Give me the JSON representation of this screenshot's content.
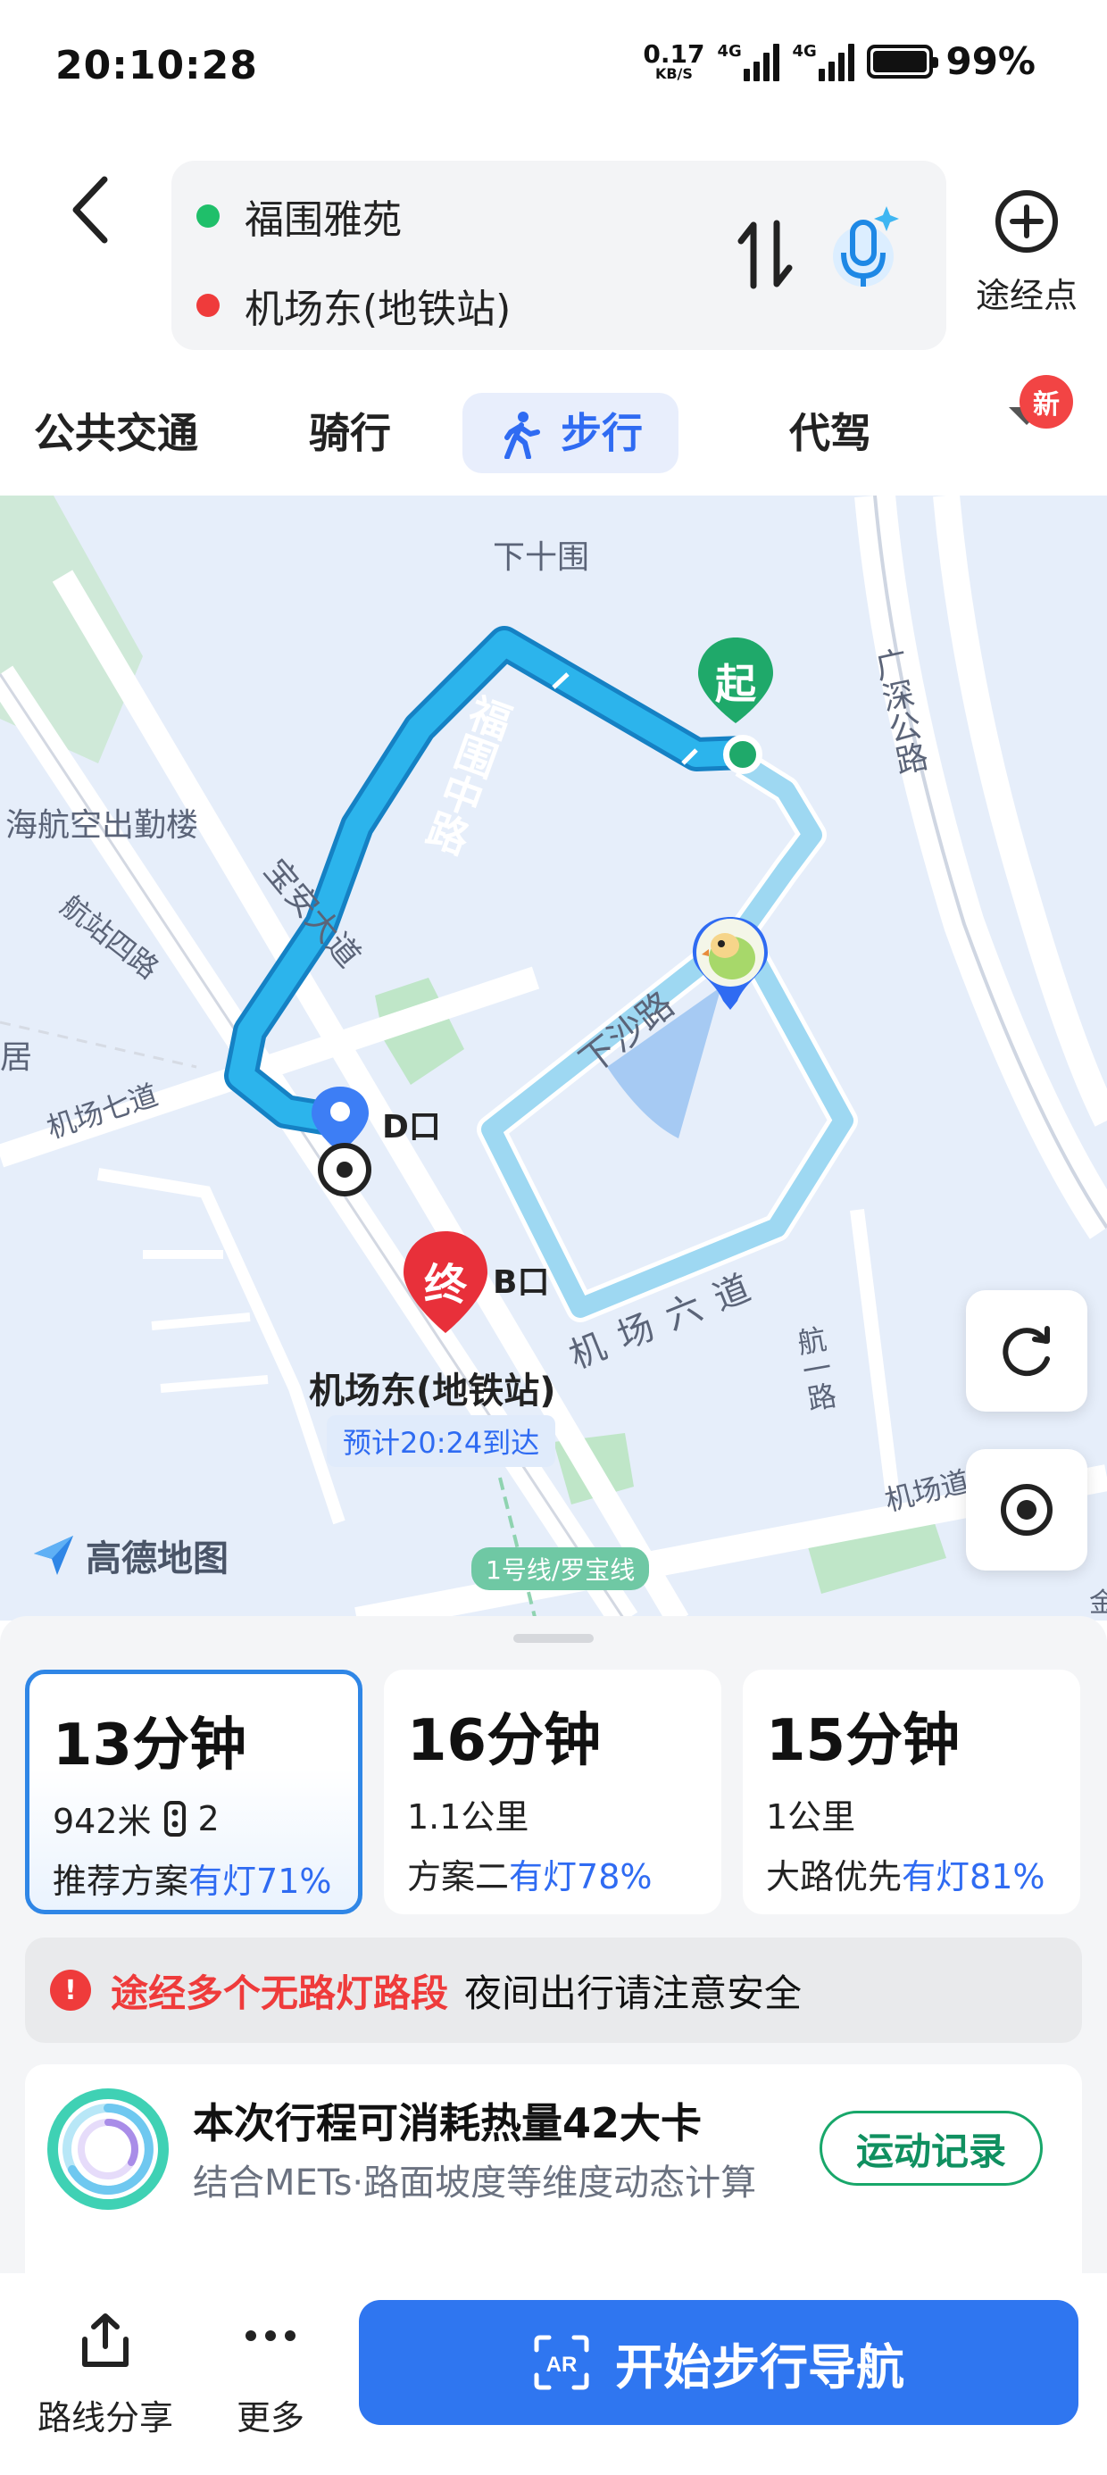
{
  "status": {
    "time": "20:10:28",
    "net_speed_value": "0.17",
    "net_speed_unit": "KB/S",
    "signal1_tag": "4G",
    "signal2_tag": "4G",
    "battery_percent": "99%"
  },
  "route": {
    "start": "福围雅苑",
    "end": "机场东(地铁站)",
    "start_color": "#1fbf6a",
    "end_color": "#ef3b3b",
    "waypoint_label": "途经点"
  },
  "tabs": [
    {
      "label": "公共交通",
      "active": false
    },
    {
      "label": "骑行",
      "active": false
    },
    {
      "label": "步行",
      "active": true
    },
    {
      "label": "代驾",
      "active": false
    }
  ],
  "new_badge": "新",
  "map": {
    "labels": {
      "xiashiwei": "下十围",
      "guangshen": "广深公路",
      "hangkong": "海航空出勤楼",
      "fuwei_rd": "福围中路",
      "baoan": "宝安大道",
      "hangzhan4": "航站四路",
      "ju": "居",
      "jichang7": "机场七道",
      "xiasha": "下沙路",
      "jichang6": "机场六道",
      "hangyi": "航一路",
      "jichangdao": "机场道",
      "jin": "金"
    },
    "start_pin": "起",
    "end_pin": "终",
    "exit_d": "D口",
    "exit_b": "B口",
    "destination_name": "机场东(地铁站)",
    "eta": "预计20:24到达",
    "metro_line": "1号线/罗宝线",
    "logo_text": "高德地图",
    "route_color": "#2aa8e8"
  },
  "plans": [
    {
      "time": "13分钟",
      "distance": "942米",
      "lights": "2",
      "plan": "推荐方案",
      "lit": "有灯71%",
      "selected": true
    },
    {
      "time": "16分钟",
      "distance": "1.1公里",
      "lights": "",
      "plan": "方案二",
      "lit": "有灯78%",
      "selected": false
    },
    {
      "time": "15分钟",
      "distance": "1公里",
      "lights": "",
      "plan": "大路优先",
      "lit": "有灯81%",
      "selected": false
    }
  ],
  "warning": {
    "icon": "!",
    "highlight": "途经多个无路灯路段",
    "text": "夜间出行请注意安全"
  },
  "calories": {
    "title": "本次行程可消耗热量42大卡",
    "subtitle": "结合METs·路面坡度等维度动态计算",
    "button": "运动记录"
  },
  "bottom": {
    "share": "路线分享",
    "more": "更多",
    "start_nav": "开始步行导航"
  }
}
